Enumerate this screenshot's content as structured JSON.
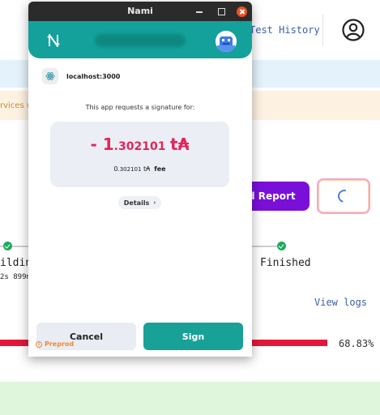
{
  "background": {
    "test_history_link": "Test History",
    "banner_orange_text": "rvices w",
    "report_button": "d Report",
    "steps": [
      {
        "label": "ildin",
        "sublabel": "2s 899m"
      },
      {
        "label": "Finished"
      }
    ],
    "view_logs": "View logs",
    "progress": {
      "percent_text": "68.83%",
      "fraction": 0.6883
    },
    "icons": [
      "account-circle-icon",
      "spinner-icon",
      "check-icon"
    ]
  },
  "window": {
    "title": "Nami",
    "controls": [
      "minimize-icon",
      "maximize-icon",
      "close-icon"
    ]
  },
  "wallet": {
    "origin": "localhost:3000",
    "request_text": "This app requests a signature for:",
    "amount": {
      "sign": "- ",
      "integer": "1",
      "decimals": ".302101",
      "unit": "t₳"
    },
    "fee": {
      "integer": "0",
      "decimals": ".302101",
      "unit": "t₳",
      "label": "fee"
    },
    "details_label": "Details",
    "cancel_label": "Cancel",
    "sign_label": "Sign",
    "network_label": "Preprod"
  },
  "colors": {
    "accent": "#14a19b",
    "amount": "#e0265c",
    "report_button": "#7a10d8",
    "progress_pass": "#1aa25a",
    "progress_fail": "#e2183a"
  }
}
